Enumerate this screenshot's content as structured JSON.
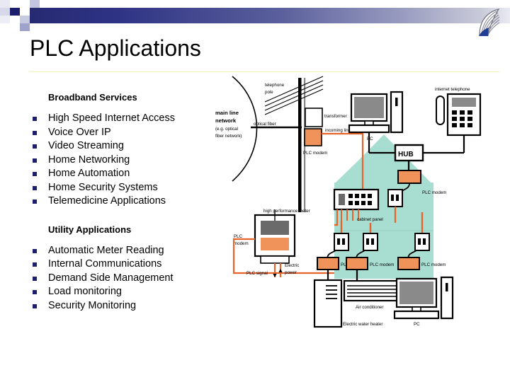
{
  "slide": {
    "title": "PLC Applications",
    "logo_icon": "feather-wing-logo-icon"
  },
  "sections": [
    {
      "heading": "Broadband Services",
      "items": [
        "High Speed Internet Access",
        "Voice Over IP",
        "Video Streaming",
        "Home Networking",
        "Home Automation",
        "Home Security Systems",
        "Telemedicine Applications"
      ]
    },
    {
      "heading": "Utility Applications",
      "items": [
        "Automatic Meter Reading",
        "Internal Communications",
        "Demand Side Management",
        "Load monitoring",
        "Security Monitoring"
      ]
    }
  ],
  "diagram": {
    "name": "plc-home-network-diagram",
    "colors": {
      "house_fill": "#a8ded2",
      "modem_orange": "#f0935a",
      "power_line": "#e8632a",
      "screen_gray": "#8a8a8a",
      "device_outline": "#000000"
    },
    "labels": {
      "main_line_network": "main line",
      "main_line_network_2": "network",
      "main_line_network_3": "(e.g. optical",
      "main_line_network_4": "fiber network)",
      "telephone_pole": "telephone",
      "telephone_pole_2": "pole",
      "optical_fiber": "optical fiber",
      "transformer": "transformer",
      "incoming_line": "incoming line",
      "plc_modem_pole": "PLC modem",
      "high_performance_meter": "high performance meter",
      "plc_modem_meter": "PLC",
      "plc_modem_meter_2": "modem",
      "plc_signal": "PLC signal",
      "electric_power": "Electric",
      "electric_power_2": "power",
      "internet_telephone": "internet telephone",
      "pc_top": "PC",
      "hub": "HUB",
      "plc_modem_hub": "PLC modem",
      "cabinet_panel": "cabinet panel",
      "plc_modem_1": "PLC modem",
      "plc_modem_2": "PLC modem",
      "plc_modem_3": "PLC modem",
      "air_conditioner": "Air conditioner",
      "electric_water_heater": "Electric water heater",
      "pc_bottom": "PC"
    }
  }
}
